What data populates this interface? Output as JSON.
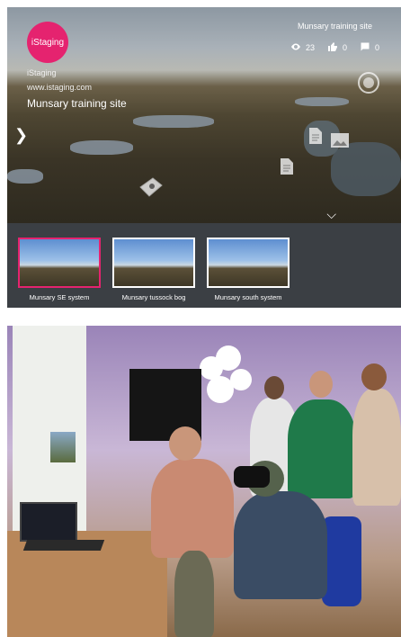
{
  "viewer": {
    "logo_text": "iStaging",
    "brand": "iStaging",
    "url": "www.istaging.com",
    "site_title": "Munsary training site",
    "header_title": "Munsary training site",
    "stats": {
      "views": "23",
      "likes": "0",
      "comments": "0"
    },
    "scenes": [
      {
        "label": "Munsary SE system",
        "active": true
      },
      {
        "label": "Munsary tussock bog",
        "active": false
      },
      {
        "label": "Munsary south system",
        "active": false
      }
    ]
  },
  "icons": {
    "views": "eye-icon",
    "likes": "thumbs-up-icon",
    "comments": "comment-icon",
    "vr": "vr-mode-icon",
    "prev": "chevron-left-icon",
    "expand": "chevron-down-icon",
    "hotspot_location": "location-hotspot-icon",
    "hotspot_document": "document-hotspot-icon",
    "hotspot_image": "image-hotspot-icon"
  },
  "colors": {
    "accent": "#e5236f",
    "panel_bg": "#3b3f44"
  }
}
